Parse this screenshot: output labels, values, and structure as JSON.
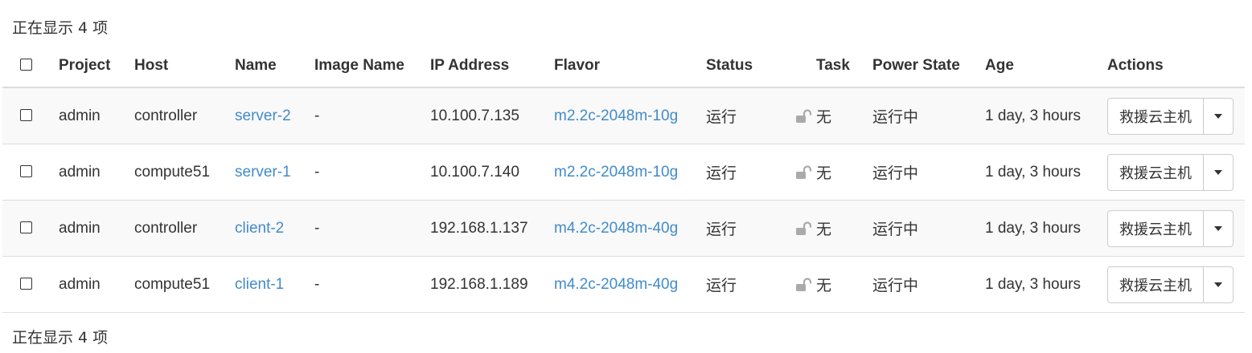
{
  "summary": {
    "top": "正在显示 4 项",
    "bottom": "正在显示 4 项"
  },
  "columns": {
    "project": "Project",
    "host": "Host",
    "name": "Name",
    "image_name": "Image Name",
    "ip_address": "IP Address",
    "flavor": "Flavor",
    "status": "Status",
    "task": "Task",
    "power_state": "Power State",
    "age": "Age",
    "actions": "Actions"
  },
  "rows": [
    {
      "project": "admin",
      "host": "controller",
      "name": "server-2",
      "image_name": "-",
      "ip": "10.100.7.135",
      "flavor": "m2.2c-2048m-10g",
      "status": "运行",
      "lock_icon": "unlocked-icon",
      "task": "无",
      "power_state": "运行中",
      "age": "1 day, 3 hours",
      "action": "救援云主机"
    },
    {
      "project": "admin",
      "host": "compute51",
      "name": "server-1",
      "image_name": "-",
      "ip": "10.100.7.140",
      "flavor": "m2.2c-2048m-10g",
      "status": "运行",
      "lock_icon": "unlocked-icon",
      "task": "无",
      "power_state": "运行中",
      "age": "1 day, 3 hours",
      "action": "救援云主机"
    },
    {
      "project": "admin",
      "host": "controller",
      "name": "client-2",
      "image_name": "-",
      "ip": "192.168.1.137",
      "flavor": "m4.2c-2048m-40g",
      "status": "运行",
      "lock_icon": "unlocked-icon",
      "task": "无",
      "power_state": "运行中",
      "age": "1 day, 3 hours",
      "action": "救援云主机"
    },
    {
      "project": "admin",
      "host": "compute51",
      "name": "client-1",
      "image_name": "-",
      "ip": "192.168.1.189",
      "flavor": "m4.2c-2048m-40g",
      "status": "运行",
      "lock_icon": "unlocked-icon",
      "task": "无",
      "power_state": "运行中",
      "age": "1 day, 3 hours",
      "action": "救援云主机"
    }
  ],
  "colors": {
    "link": "#428bca",
    "stripe": "#f9f9f9",
    "border": "#dddddd",
    "text": "#333333",
    "lock": "#aaaaaa"
  }
}
